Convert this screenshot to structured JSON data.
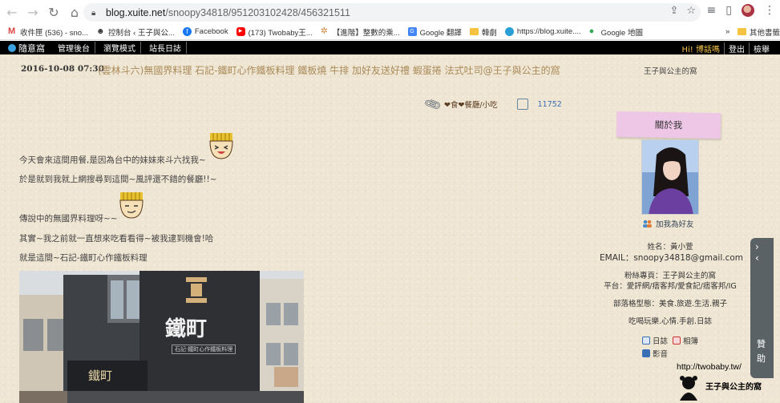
{
  "browser": {
    "url_host": "blog.xuite.net",
    "url_path": "/snoopy34818/951203102428/456321511",
    "bookmarks": [
      {
        "label": "收件匣 (536) - sno..."
      },
      {
        "label": "控制台 ‹ 王子與公..."
      },
      {
        "label": "Facebook"
      },
      {
        "label": "(173) Twobaby王..."
      },
      {
        "label": "【進階】整數的乘..."
      },
      {
        "label": "Google 翻譯"
      },
      {
        "label": "韓劇"
      },
      {
        "label": "https://blog.xuite...."
      },
      {
        "label": "Google 地圖"
      }
    ],
    "bookmarks_overflow": "»",
    "other_bookmarks": "其他書籤"
  },
  "site_bar": {
    "logo": "隨意窩",
    "links": [
      "管理後台",
      "瀏覽模式",
      "站長日誌"
    ],
    "greeting": "Hi! 博話嗎",
    "logout": "登出",
    "search": "檢舉"
  },
  "post": {
    "date": "2016-10-08 07:30",
    "title": "(雲林斗六)無國界料理 石記-鐵町心作鐵板料理 鐵板燒 牛排 加好友送好禮 蝦蛋捲 法式吐司@王子與公主的窩",
    "category": "❤食❤餐廳/小吃",
    "views": "11752",
    "paragraphs": [
      "今天會來這間用餐,是因為台中的妹妹來斗六找我~",
      "於是就到我就上網搜尋到這間~風評還不錯的餐廳!!~",
      "傳說中的無國界料理呀~~",
      "其實~我之前就一直想來吃看看得~被我逮到機會!哈",
      "就是這間~石記-鐵町心作鐵板料理"
    ],
    "photo_sign": "鐵町",
    "photo_sign_sub": "石記·鐵町心作鐵板料理"
  },
  "sidebar": {
    "blog_name": "王子與公主的窩",
    "about_title": "關於我",
    "add_friend": "加我為好友",
    "name_line": "姓名：黃小萱",
    "email_line": "EMAIL：snoopy34818@gmail.com",
    "fans_line": "粉絲專頁：王子與公主的窩",
    "platform_line": "平台：愛評網/痞客邦/愛食記/痞客邦/IG",
    "type_line": "部落格型態：美食.旅遊.生活.親子",
    "hobby_line": "吃喝玩樂.心情.手創.日誌",
    "links": [
      {
        "label": "日誌",
        "color": "#3a6fb5"
      },
      {
        "label": "相簿",
        "color": "#c33"
      },
      {
        "label": "影音",
        "color": "#3a6fb5"
      }
    ]
  },
  "float_panel": {
    "label": "贊助"
  },
  "watermark": {
    "url": "http://twobaby.tw/",
    "name": "王子與公主的窩"
  }
}
